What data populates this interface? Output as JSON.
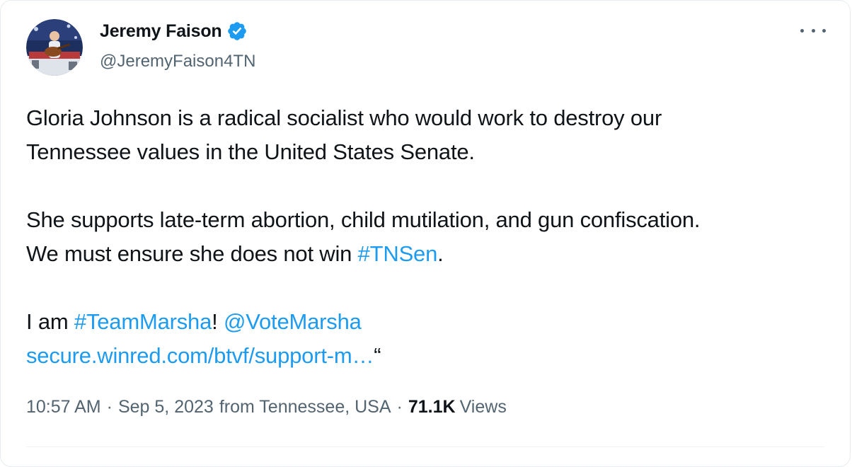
{
  "author": {
    "name": "Jeremy Faison",
    "handle": "@JeremyFaison4TN",
    "verified": true,
    "avatar_icon": "profile-photo"
  },
  "tweet": {
    "line1": "Gloria Johnson is a radical socialist who would work to destroy our",
    "line2": "Tennessee values in the United States Senate.",
    "line3": "She supports late-term abortion, child mutilation, and gun confiscation.",
    "line4_pre": "We must ensure she does not win ",
    "hashtag_tnsen": "#TNSen",
    "line4_post": ".",
    "line5_pre": "I am ",
    "hashtag_teammarsha": "#TeamMarsha",
    "line5_mid": "! ",
    "mention": "@VoteMarsha",
    "url": "secure.winred.com/btvf/support-m…",
    "url_suffix": "“"
  },
  "meta": {
    "time": "10:57 AM",
    "date": "Sep 5, 2023",
    "location": "from Tennessee, USA",
    "dot": "·",
    "views_count": "71.1K",
    "views_label": "Views"
  },
  "colors": {
    "link": "#1d9bf0",
    "secondary_text": "#536471",
    "primary_text": "#0f1419"
  }
}
